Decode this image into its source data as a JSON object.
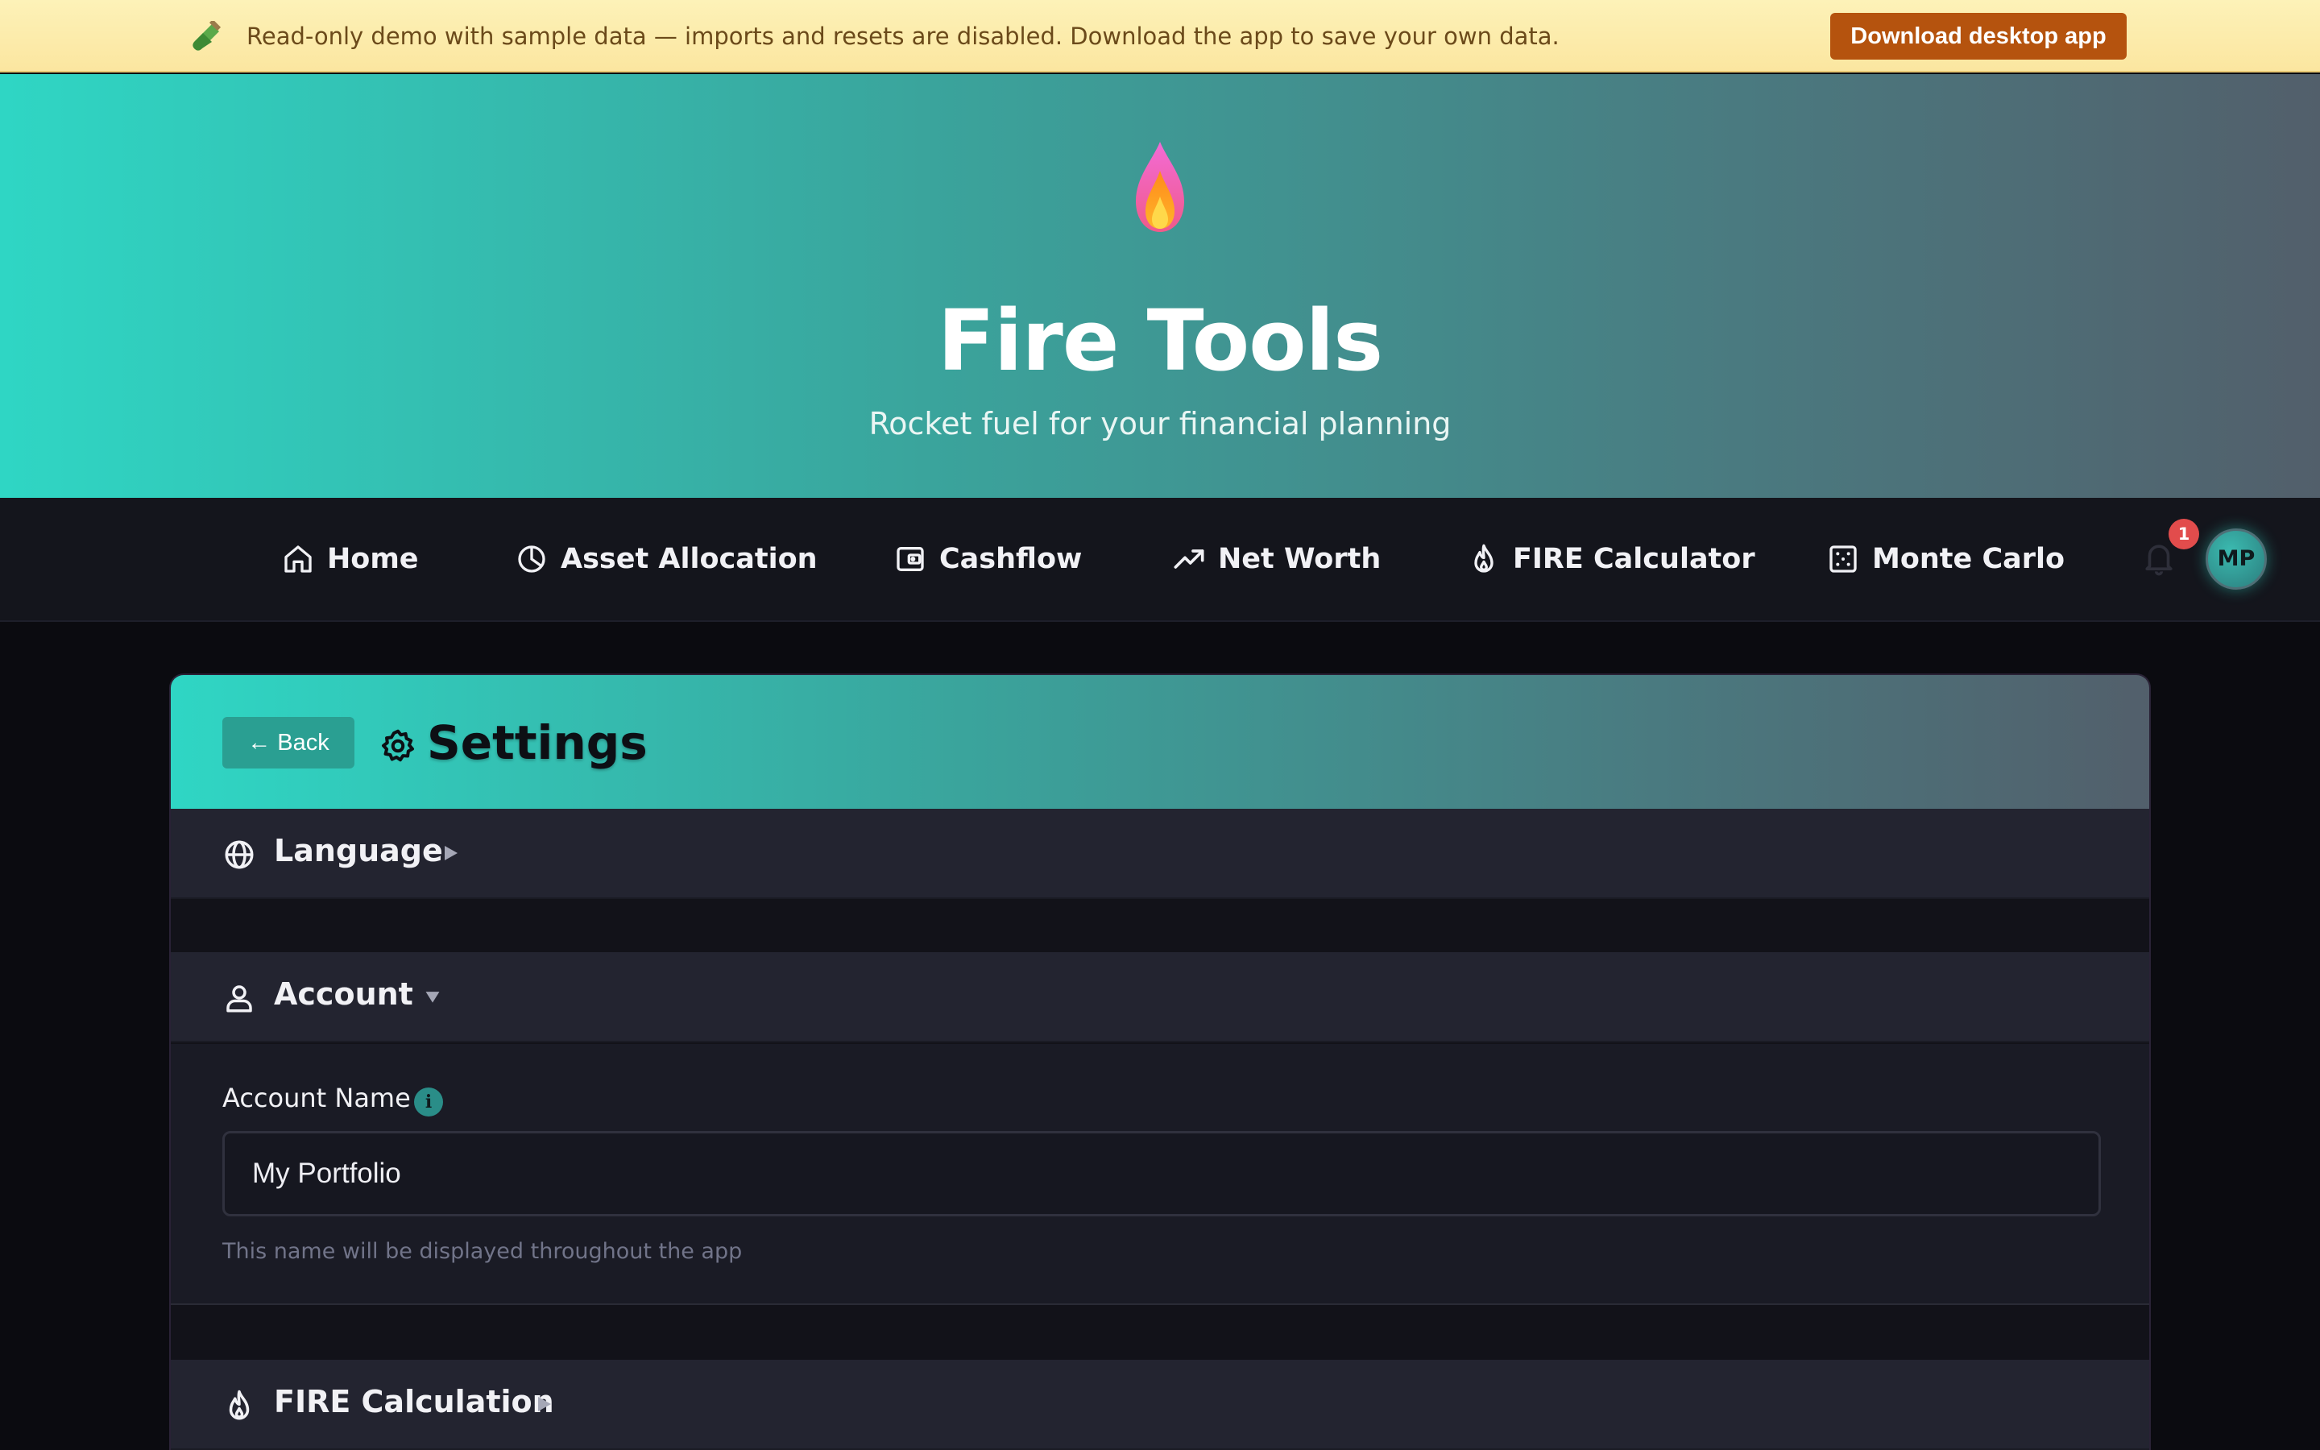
{
  "banner": {
    "icon": "test-tube-icon",
    "message": "Read-only demo with sample data — imports and resets are disabled. Download the app to save your own data.",
    "button_label": "Download desktop app",
    "background": "#fbe6a0",
    "button_color": "#b5530e"
  },
  "hero": {
    "logo_icon": "flame-logo-icon",
    "title": "Fire Tools",
    "subtitle": "Rocket fuel for your financial planning",
    "gradient_start": "#2fd6c4",
    "gradient_end": "#525f6b"
  },
  "nav": {
    "items": [
      {
        "label": "Home",
        "icon": "home-icon"
      },
      {
        "label": "Asset Allocation",
        "icon": "pie-chart-icon"
      },
      {
        "label": "Cashflow",
        "icon": "wallet-icon"
      },
      {
        "label": "Net Worth",
        "icon": "trending-up-icon"
      },
      {
        "label": "FIRE Calculator",
        "icon": "flame-icon"
      },
      {
        "label": "Monte Carlo",
        "icon": "dice-icon"
      }
    ],
    "notification_count": "1",
    "avatar_initials": "MP"
  },
  "settings": {
    "back_label": "← Back",
    "title": "Settings",
    "sections": [
      {
        "title": "Language",
        "icon": "globe-icon",
        "expanded": false
      },
      {
        "title": "Account",
        "icon": "user-icon",
        "expanded": true
      },
      {
        "title": "FIRE Calculation",
        "icon": "flame-icon",
        "expanded": false
      }
    ],
    "account": {
      "field_label": "Account Name",
      "field_value": "My Portfolio",
      "field_hint": "This name will be displayed throughout the app"
    }
  }
}
